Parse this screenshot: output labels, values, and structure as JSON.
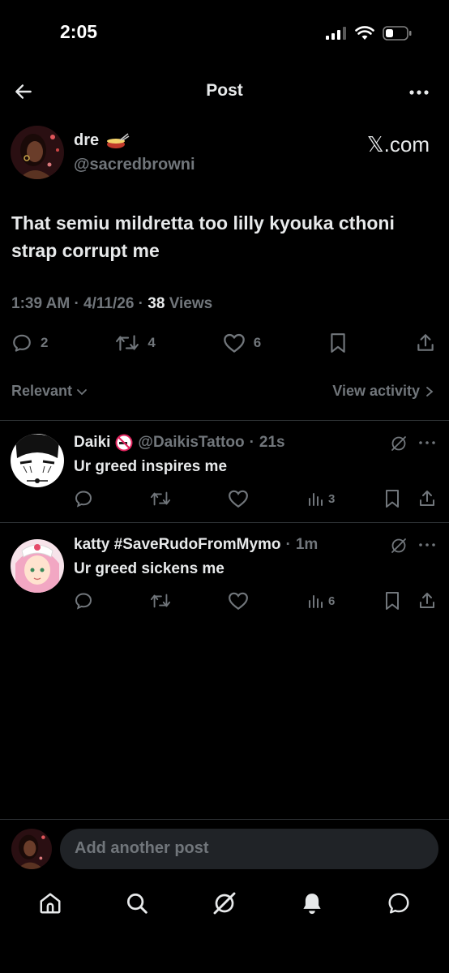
{
  "status": {
    "time": "2:05"
  },
  "header": {
    "title": "Post"
  },
  "post": {
    "author_name": "dre",
    "author_handle": "@sacredbrowni",
    "source_badge": "𝕏.com",
    "text": "That semiu mildretta too lilly kyouka cthoni strap corrupt me",
    "time": "1:39 AM",
    "date": "4/11/26",
    "views_count": "38",
    "views_label": "Views",
    "replies": "2",
    "reposts": "4",
    "likes": "6"
  },
  "filters": {
    "sort_label": "Relevant",
    "view_activity": "View activity"
  },
  "replies": [
    {
      "name": "Daiki",
      "handle": "@DaikisTattoo",
      "time": "21s",
      "text": "Ur greed inspires me",
      "views": "3"
    },
    {
      "name": "katty #SaveRudoFromMymo",
      "handle": "",
      "time": "1m",
      "text": "Ur greed sickens me",
      "views": "6"
    }
  ],
  "compose": {
    "placeholder": "Add another post"
  },
  "colors": {
    "background": "#000000",
    "muted": "#71767b",
    "text": "#e7e9ea",
    "divider": "#2f3336"
  },
  "icons": [
    "back-arrow-icon",
    "more-icon",
    "reply-icon",
    "repost-icon",
    "like-icon",
    "bookmark-icon",
    "share-icon",
    "views-icon",
    "grok-icon",
    "home-icon",
    "search-icon",
    "notifications-icon",
    "messages-icon"
  ]
}
